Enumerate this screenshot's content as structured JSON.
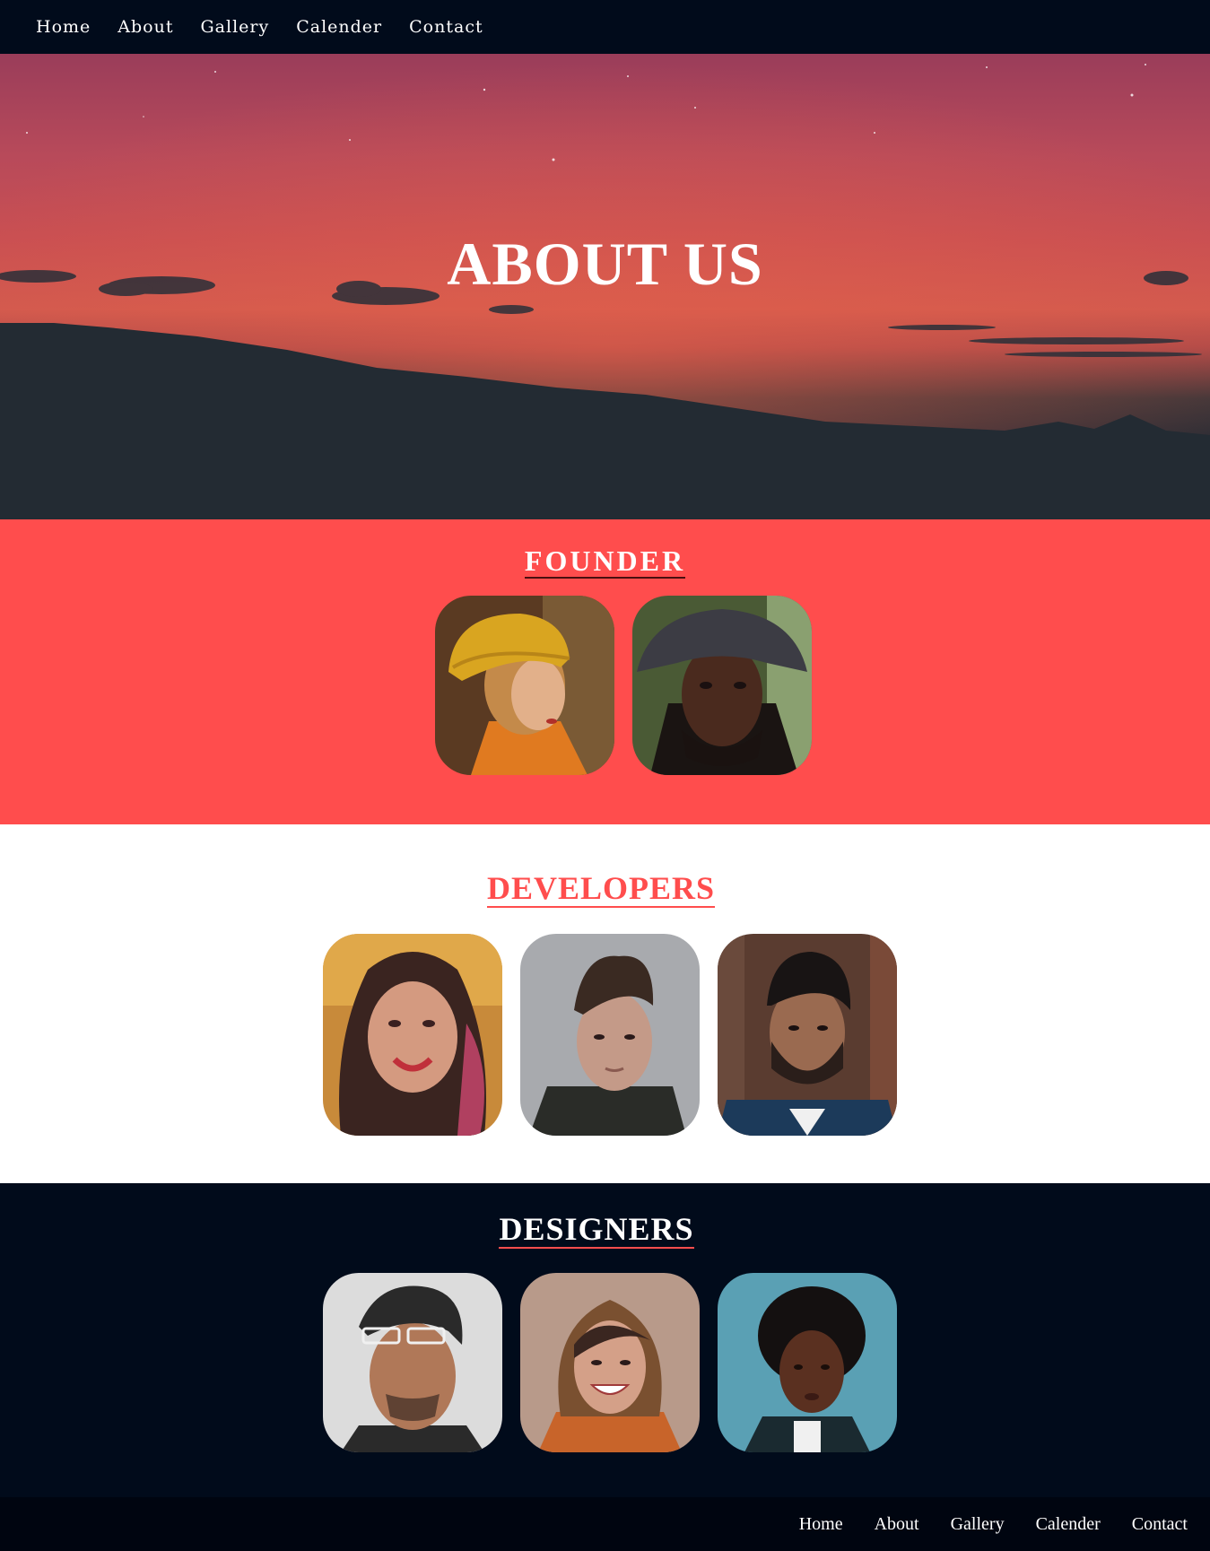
{
  "nav": {
    "items": [
      "Home",
      "About",
      "Gallery",
      "Calender",
      "Contact"
    ]
  },
  "hero": {
    "title": "ABOUT US"
  },
  "founder": {
    "heading": "FOUNDER",
    "members": [
      {
        "image": "woman-yellow-beanie-portrait"
      },
      {
        "image": "man-bucket-hat-dreadlocks-portrait"
      }
    ]
  },
  "developers": {
    "heading": "DEVELOPERS",
    "members": [
      {
        "image": "smiling-woman-curly-hair-portrait"
      },
      {
        "image": "man-quiff-hair-dark-jacket-portrait"
      },
      {
        "image": "bearded-man-wooden-wall-portrait"
      }
    ]
  },
  "designers": {
    "heading": "DESIGNERS",
    "members": [
      {
        "image": "man-glasses-beanie-portrait"
      },
      {
        "image": "smiling-woman-bangs-orange-sweater-portrait"
      },
      {
        "image": "woman-afro-blue-background-portrait"
      }
    ]
  },
  "footer": {
    "items": [
      "Home",
      "About",
      "Gallery",
      "Calender",
      "Contact"
    ]
  },
  "colors": {
    "accent": "#ff4d4d",
    "dark": "#010b1b",
    "white": "#ffffff"
  }
}
